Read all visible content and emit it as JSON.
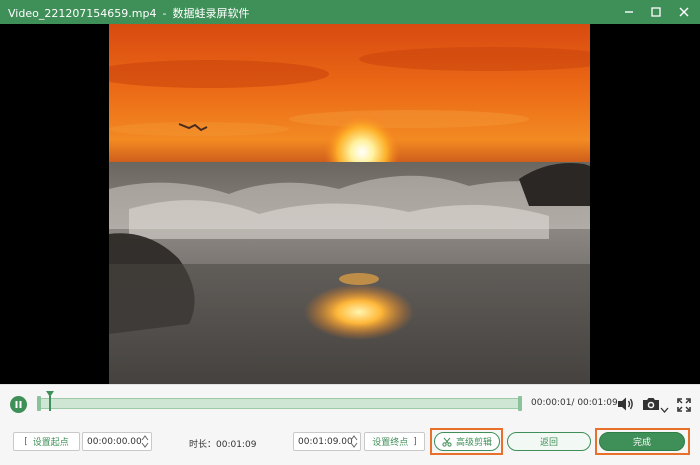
{
  "window": {
    "file_name": "Video_221207154659.mp4",
    "separator": "-",
    "app_name": "数据蛙录屏软件",
    "title_color": "#3f8f58",
    "accent_color": "#3f8f58",
    "highlight_color": "#e8702a"
  },
  "titlebar_buttons": [
    "minimize-icon",
    "maximize-icon",
    "close-icon"
  ],
  "video": {
    "scene": "sunset-over-ocean-waves",
    "playback_state": "playing"
  },
  "player": {
    "play_pause_icon": "pause-icon",
    "time_display": "00:00:01/ 00:01:09",
    "volume_icon": "volume-icon",
    "screenshot_icon": "camera-icon",
    "dropdown_icon": "chevron-down-icon",
    "fullscreen_icon": "fullscreen-icon"
  },
  "edit": {
    "set_start_label": "设置起点",
    "start_time": "00:00:00.00",
    "duration_label": "时长：00:01:09",
    "end_time": "00:01:09.00",
    "set_end_label": "设置终点",
    "advanced_label": "高级剪辑",
    "back_label": "返回",
    "finish_label": "完成"
  }
}
